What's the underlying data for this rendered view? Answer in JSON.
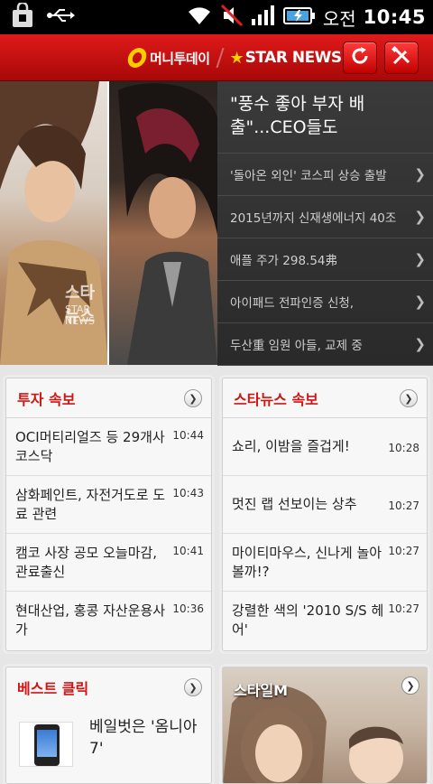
{
  "status": {
    "ampm": "오전",
    "clock": "10:45"
  },
  "header": {
    "brand1": "머니투데이",
    "brand2": "STAR NEWS",
    "refresh_icon": "refresh-icon",
    "settings_icon": "tools-icon"
  },
  "hero": {
    "watermark_ko": "스타뉴스",
    "watermark_en": "STAR NEWS",
    "headline": "\"풍수 좋아 부자 배출\"...CEO들도",
    "items": [
      "'돌아온 외인' 코스피 상승 출발",
      "2015년까지 신재생에너지 40조",
      "애플 주가 298.54弗",
      "아이패드 전파인증 신청,",
      "두산重 임원 아들, 교제 중"
    ]
  },
  "invest": {
    "title": "투자 속보",
    "rows": [
      {
        "text": "OCI머티리얼즈 등 29개사 코스닥",
        "time": "10:44"
      },
      {
        "text": "삼화페인트, 자전거도로 도료 관련",
        "time": "10:43"
      },
      {
        "text": "캠코 사장 공모 오늘마감, 관료출신",
        "time": "10:41"
      },
      {
        "text": "현대산업, 홍콩 자산운용사가",
        "time": "10:36"
      }
    ]
  },
  "starnews": {
    "title": "스타뉴스 속보",
    "rows": [
      {
        "text": "쇼리, 이밤을 즐겁게!",
        "time": "10:28"
      },
      {
        "text": "멋진 랩 선보이는 상추",
        "time": "10:27"
      },
      {
        "text": "마이티마우스, 신나게 놀아볼까!?",
        "time": "10:27"
      },
      {
        "text": "강렬한 색의 '2010 S/S 헤어'",
        "time": "10:27"
      }
    ]
  },
  "best": {
    "title": "베스트 클릭",
    "headline": "베일벗은 '옴니아7'"
  },
  "style": {
    "title": "스타일M"
  },
  "colors": {
    "brand_red": "#d11414",
    "header_bg": "#c40f0f",
    "accent_yellow": "#ffcc00"
  }
}
